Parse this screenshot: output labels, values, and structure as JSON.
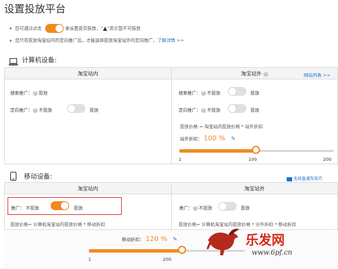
{
  "page": {
    "title": "设置投放平台"
  },
  "tips": {
    "line1_pre": "您可通过点击",
    "line1_mid": "来设置是否投放，“",
    "line1_post": "”表示暂不可投放",
    "line2": "您只有投放淘宝站内的定向推广后，才能选择投放淘宝站外的定向推广，",
    "line2_link": "了解详情 >>"
  },
  "computer": {
    "heading": "计算机设备:",
    "inside": {
      "header": "淘宝站内",
      "search": {
        "label": "搜索推广：",
        "state": "投放"
      },
      "targeted": {
        "label": "定向推广：",
        "off": "不投放",
        "on": "投放"
      }
    },
    "outside": {
      "header": "淘宝站外",
      "site_list_link": "网站列表 >>",
      "search": {
        "label": "搜索推广：",
        "off": "不投放",
        "on": "投放"
      },
      "targeted": {
        "label": "定向推广：",
        "off": "不投放",
        "on": "投放"
      },
      "formula": "投放价格 = 淘宝站内投放价格 * 站外折扣",
      "discount_label": "站外折扣：",
      "discount_value": "100 %",
      "slider": {
        "min": 1,
        "max": 200,
        "mid_label": "100",
        "value": 100
      }
    }
  },
  "mobile": {
    "heading": "移动设备:",
    "no_device_link": "无线直通车技巧",
    "inside": {
      "header": "淘宝站内",
      "promo": {
        "label": "推广：",
        "off": "不投放",
        "on": "投放"
      },
      "formula": "投放价格= 计算机淘宝站内投放价格 * 移动折扣"
    },
    "outside": {
      "header": "淘宝站外",
      "promo": {
        "label": "推广：",
        "off": "不投放",
        "on": "投放"
      },
      "formula": "投放价格= 计算机淘宝站内投放价格 * 计外折扣 * 移动折扣"
    },
    "discount_label": "移动折扣：",
    "discount_value": "120 %",
    "slider": {
      "min": 1,
      "max": 200,
      "value": 120
    }
  },
  "watermark": {
    "text": "乐发网",
    "url": "www.6pf.cn"
  },
  "colors": {
    "accent": "#f08a1f",
    "link": "#1a73c9",
    "highlight": "#e23c3c"
  }
}
